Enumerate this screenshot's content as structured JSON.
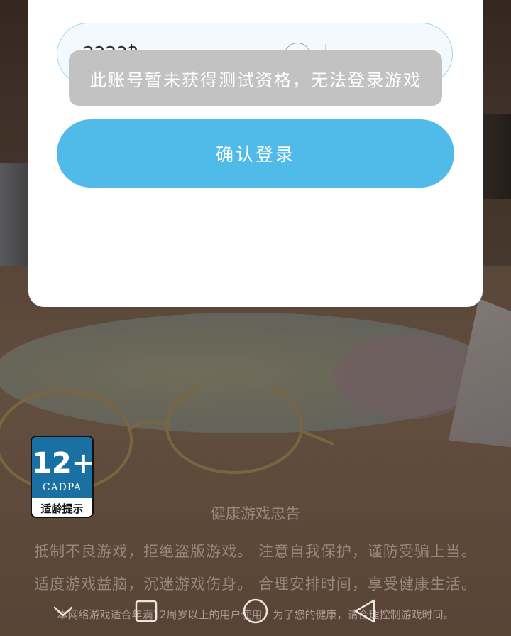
{
  "login": {
    "account_value": "22222",
    "toast_message": "此账号暂未获得测试资格，无法登录游戏",
    "confirm_label": "确认登录"
  },
  "age_rating": {
    "age": "12+",
    "org": "CADPA",
    "label": "适龄提示"
  },
  "health_notice": {
    "title": "健康游戏忠告",
    "line1": "抵制不良游戏，拒绝盗版游戏。 注意自我保护，谨防受骗上当。",
    "line2": "适度游戏益脑，沉迷游戏伤身。 合理安排时间，享受健康生活。",
    "footer": "本网络游戏适合年满12周岁以上的用户使用，为了您的健康，请合理控制游戏时间。"
  },
  "navbar": {
    "buttons": [
      "chevron-down-icon",
      "recents-square-icon",
      "home-circle-icon",
      "back-triangle-icon"
    ]
  },
  "colors": {
    "accent": "#50bbe8",
    "toast_bg": "#c2c2c2",
    "badge_blue": "#1a6fa3"
  }
}
